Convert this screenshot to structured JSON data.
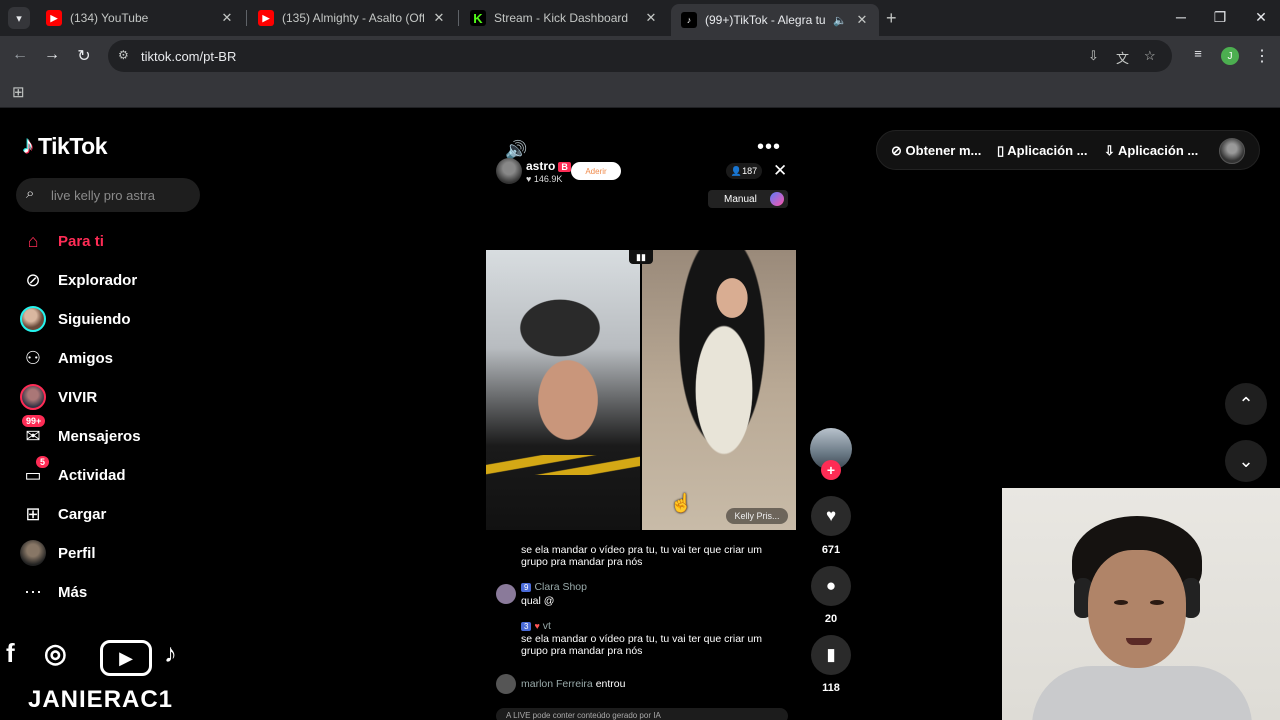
{
  "browser": {
    "tabs": [
      {
        "title": "(134) YouTube",
        "favicon": "youtube-icon",
        "active": false
      },
      {
        "title": "(135) Almighty - Asalto (Official",
        "favicon": "youtube-icon",
        "active": false
      },
      {
        "title": "Stream - Kick Dashboard",
        "favicon": "kick-icon",
        "active": false
      },
      {
        "title": "(99+)TikTok - Alegra tu día",
        "favicon": "tiktok-icon",
        "active": true
      }
    ],
    "url": "tiktok.com/pt-BR",
    "profile_initial": "J"
  },
  "tiktok": {
    "logo_text": "TikTok",
    "search_placeholder": "live kelly pro astra",
    "nav": [
      {
        "label": "Para ti",
        "icon": "home-icon",
        "active": true
      },
      {
        "label": "Explorador",
        "icon": "compass-icon"
      },
      {
        "label": "Siguiendo",
        "icon": "avatar-icon"
      },
      {
        "label": "Amigos",
        "icon": "friends-icon"
      },
      {
        "label": "VIVIR",
        "icon": "live-avatar-icon"
      },
      {
        "label": "Mensajeros",
        "icon": "messages-icon",
        "badge": "99+"
      },
      {
        "label": "Actividad",
        "icon": "activity-icon",
        "badge": "5"
      },
      {
        "label": "Cargar",
        "icon": "upload-icon"
      },
      {
        "label": "Perfil",
        "icon": "profile-avatar-icon"
      },
      {
        "label": "Más",
        "icon": "more-icon"
      }
    ],
    "top_right": {
      "items": [
        "Obtener m...",
        "Aplicación ...",
        "Aplicación ..."
      ]
    }
  },
  "live": {
    "host_name": "astro",
    "host_badge": "B",
    "host_likes": "146.9K",
    "join_label": "Aderir",
    "viewers": "187",
    "mode_label": "Manual",
    "video_label": "Kelly Pris...",
    "chat": [
      {
        "user": "",
        "text": "se ela mandar o vídeo pra tu, tu vai ter que criar um grupo pra mandar pra nós"
      },
      {
        "user": "Clara Shop",
        "level": "9",
        "text": "qual @"
      },
      {
        "user": "vt",
        "level": "3",
        "text": "se ela mandar o vídeo pra tu, tu vai ter que criar um grupo pra mandar pra nós"
      },
      {
        "user": "marlon Ferreira",
        "text": "entrou"
      }
    ],
    "chat_footer": "A LIVE pode conter conteúdo gerado por IA",
    "likes": "671",
    "comments": "20",
    "saves": "118"
  },
  "overlay": {
    "channel_name": "JANIERAC1"
  }
}
